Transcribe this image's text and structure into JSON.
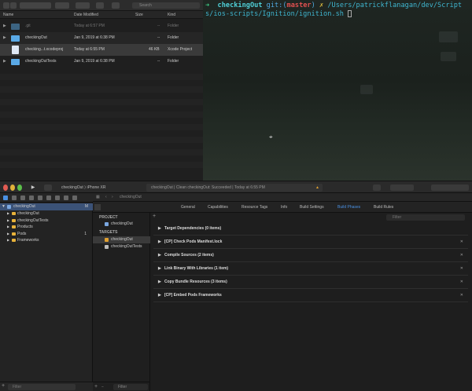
{
  "finder": {
    "search_placeholder": "Search",
    "columns": {
      "name": "Name",
      "date": "Date Modified",
      "size": "Size",
      "kind": "Kind"
    },
    "rows": [
      {
        "name": ".git",
        "date": "Today at 6:57 PM",
        "size": "--",
        "kind": "Folder",
        "icon": "folder-icon",
        "dim": true
      },
      {
        "name": "checkingOut",
        "date": "Jan 9, 2019 at 6:38 PM",
        "size": "--",
        "kind": "Folder",
        "icon": "folder-icon"
      },
      {
        "name": "checking...t.xcodeproj",
        "date": "Today at 6:55 PM",
        "size": "46 KB",
        "kind": "Xcode Project",
        "icon": "xcodeproj-icon"
      },
      {
        "name": "checkingOutTests",
        "date": "Jan 9, 2019 at 6:38 PM",
        "size": "--",
        "kind": "Folder",
        "icon": "folder-icon"
      }
    ]
  },
  "terminal": {
    "arrow": "➜",
    "dir": "checkingOut",
    "git": "git:",
    "paren_open": "(",
    "branch": "master",
    "paren_close": ")",
    "dirty": "✗",
    "command": "/Users/patrickflanagan/dev/Scripts/ios-scripts/Ignition/ignition.sh"
  },
  "xcode": {
    "scheme": "checkingOut ⟩ iPhone XR",
    "activity": "checkingOut | Clean checkingOut: Succeeded | Today at 6:55 PM",
    "warning_count": "▲",
    "navigator": {
      "project": "checkingOut",
      "project_badge": "M",
      "items": [
        {
          "label": "checkingOut",
          "badge": ""
        },
        {
          "label": "checkingOutTests",
          "badge": ""
        },
        {
          "label": "Products",
          "badge": ""
        },
        {
          "label": "Pods",
          "badge": "1"
        },
        {
          "label": "Frameworks",
          "badge": ""
        }
      ],
      "filter": "Filter"
    },
    "breadcrumb": "checkingOut",
    "tabs": [
      "General",
      "Capabilities",
      "Resource Tags",
      "Info",
      "Build Settings",
      "Build Phases",
      "Build Rules"
    ],
    "active_tab": "Build Phases",
    "project_header": "PROJECT",
    "project_item": "checkingOut",
    "targets_header": "TARGETS",
    "targets": [
      "checkingOut",
      "checkingOutTests"
    ],
    "targets_filter": "Filter",
    "phase_filter": "Filter",
    "phases": [
      {
        "label": "Target Dependencies (0 items)",
        "removable": false
      },
      {
        "label": "[CP] Check Pods Manifest.lock",
        "removable": true
      },
      {
        "label": "Compile Sources (2 items)",
        "removable": true
      },
      {
        "label": "Link Binary With Libraries (1 item)",
        "removable": true
      },
      {
        "label": "Copy Bundle Resources (3 items)",
        "removable": true
      },
      {
        "label": "[CP] Embed Pods Frameworks",
        "removable": true
      }
    ],
    "remove_glyph": "✕",
    "add_glyph": "+"
  },
  "colors": {
    "accent": "#4a90e2",
    "folder": "#5aa9e6",
    "terminal_prompt": "#3fd68a",
    "terminal_dir": "#4fd0d8",
    "terminal_branch": "#e05050"
  }
}
